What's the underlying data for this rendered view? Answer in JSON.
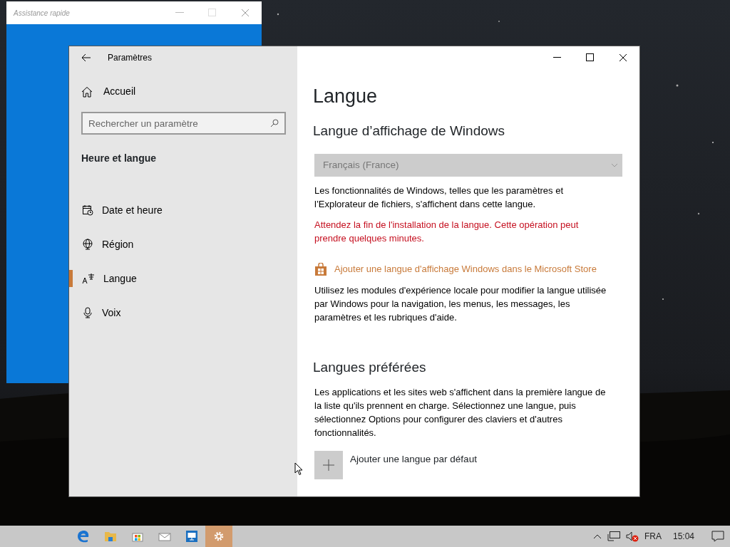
{
  "quick_assist": {
    "title": "Assistance rapide"
  },
  "settings": {
    "title": "Paramètres",
    "home": "Accueil",
    "search": {
      "placeholder": "Rechercher un paramètre"
    },
    "section": "Heure et langue",
    "nav": [
      {
        "label": "Date et heure",
        "kind": "calendar",
        "selected": false
      },
      {
        "label": "Région",
        "kind": "globe",
        "selected": false
      },
      {
        "label": "Langue",
        "kind": "language",
        "selected": true
      },
      {
        "label": "Voix",
        "kind": "microphone",
        "selected": false
      }
    ],
    "page": {
      "title": "Langue",
      "display_heading": "Langue d’affichage de Windows",
      "dropdown": {
        "value": "Français (France)",
        "disabled": true
      },
      "display_note": "Les fonctionnalités de Windows, telles que les paramètres et l’Explorateur de fichiers, s'affichent dans cette langue.",
      "warning": "Attendez la fin de l'installation de la langue. Cette opération peut prendre quelques minutes.",
      "store_link": "Ajouter une langue d'affichage Windows dans le Microsoft Store",
      "modules_note": "Utilisez les modules d'expérience locale pour modifier la langue utilisée par Windows pour la navigation, les menus, les messages, les paramètres et les rubriques d'aide.",
      "preferred_heading": "Langues préférées",
      "preferred_note": "Les applications et les sites web s'affichent dans la première langue de la liste qu'ils prennent en charge. Sélectionnez une langue, puis sélectionnez Options pour configurer des claviers et d'autres fonctionnalités.",
      "add_label": "Ajouter une langue par défaut"
    }
  },
  "taskbar": {
    "apps": [
      {
        "kind": "edge",
        "selected": false
      },
      {
        "kind": "folder",
        "selected": false
      },
      {
        "kind": "store",
        "selected": false
      },
      {
        "kind": "mail",
        "selected": false
      },
      {
        "kind": "remote",
        "selected": false
      },
      {
        "kind": "settings",
        "selected": true
      }
    ],
    "language": "FRA",
    "time": "15:04"
  }
}
